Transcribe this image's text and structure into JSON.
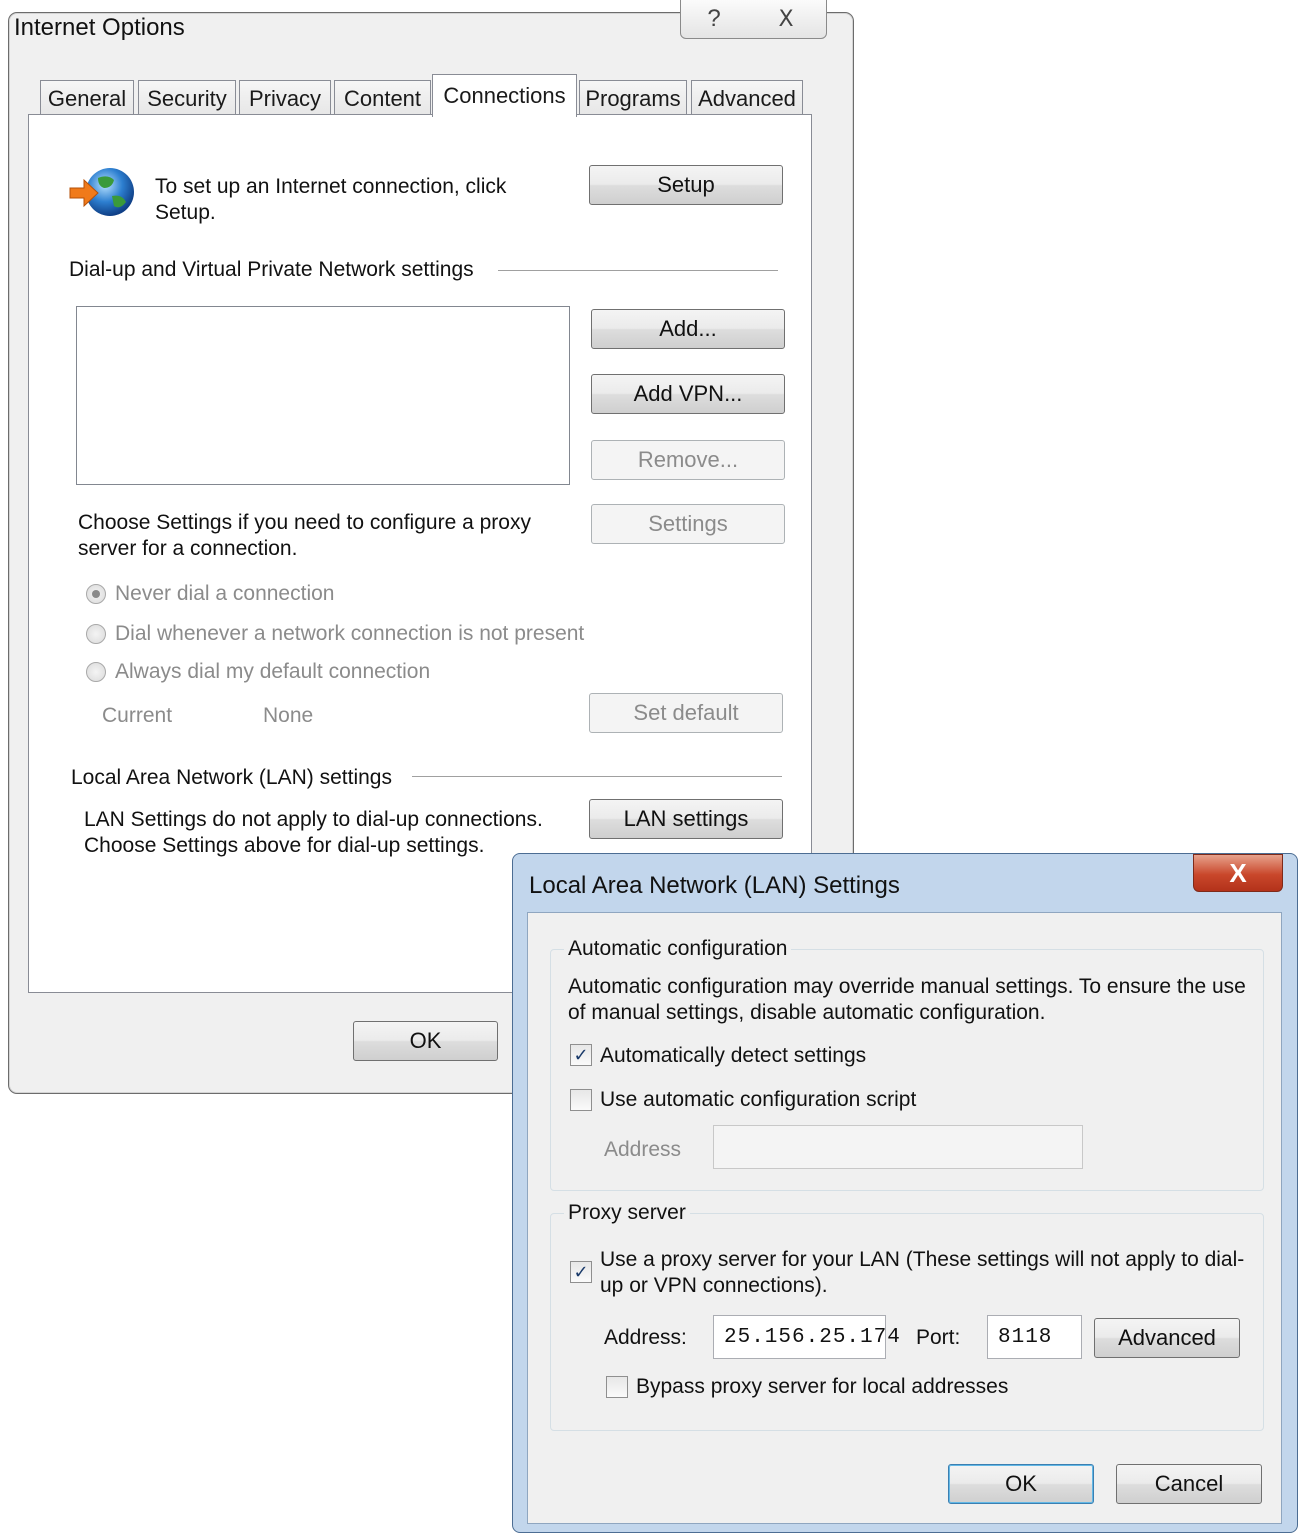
{
  "internet_options": {
    "title": "Internet Options",
    "help_symbol": "?",
    "close_symbol": "X",
    "tabs": [
      {
        "label": "General"
      },
      {
        "label": "Security"
      },
      {
        "label": "Privacy"
      },
      {
        "label": "Content"
      },
      {
        "label": "Connections"
      },
      {
        "label": "Programs"
      },
      {
        "label": "Advanced"
      }
    ],
    "active_tab": "Connections",
    "setup_text": "To set up an Internet connection, click Setup.",
    "setup_button": "Setup",
    "dialup_group": "Dial-up and Virtual Private Network settings",
    "add_button": "Add...",
    "add_vpn_button": "Add VPN...",
    "remove_button": "Remove...",
    "proxy_hint": "Choose Settings if you need to configure a proxy server for a connection.",
    "settings_button": "Settings",
    "radios": [
      {
        "label": "Never dial a connection",
        "selected": true
      },
      {
        "label": "Dial whenever a network connection is not present",
        "selected": false
      },
      {
        "label": "Always dial my default connection",
        "selected": false
      }
    ],
    "current_label": "Current",
    "current_value": "None",
    "set_default_button": "Set default",
    "lan_group": "Local Area Network (LAN) settings",
    "lan_text": "LAN Settings do not apply to dial-up connections. Choose Settings above for dial-up settings.",
    "lan_button": "LAN settings",
    "ok_button": "OK"
  },
  "lan_settings": {
    "title": "Local Area Network (LAN) Settings",
    "close_symbol": "X",
    "auto_config": {
      "legend": "Automatic configuration",
      "description": "Automatic configuration may override manual settings.  To ensure the use of manual settings, disable automatic configuration.",
      "auto_detect_label": "Automatically detect settings",
      "auto_detect_checked": true,
      "script_label": "Use automatic configuration script",
      "script_checked": false,
      "address_label": "Address",
      "address_value": ""
    },
    "proxy": {
      "legend": "Proxy server",
      "use_proxy_label": "Use a proxy server for your LAN (These settings will not apply to dial-up or VPN connections).",
      "use_proxy_checked": true,
      "address_label": "Address:",
      "address_value": "25.156.25.174",
      "port_label": "Port:",
      "port_value": "8118",
      "advanced_button": "Advanced",
      "bypass_label": "Bypass proxy server for local addresses",
      "bypass_checked": false
    },
    "ok_button": "OK",
    "cancel_button": "Cancel",
    "check_mark": "✓"
  }
}
